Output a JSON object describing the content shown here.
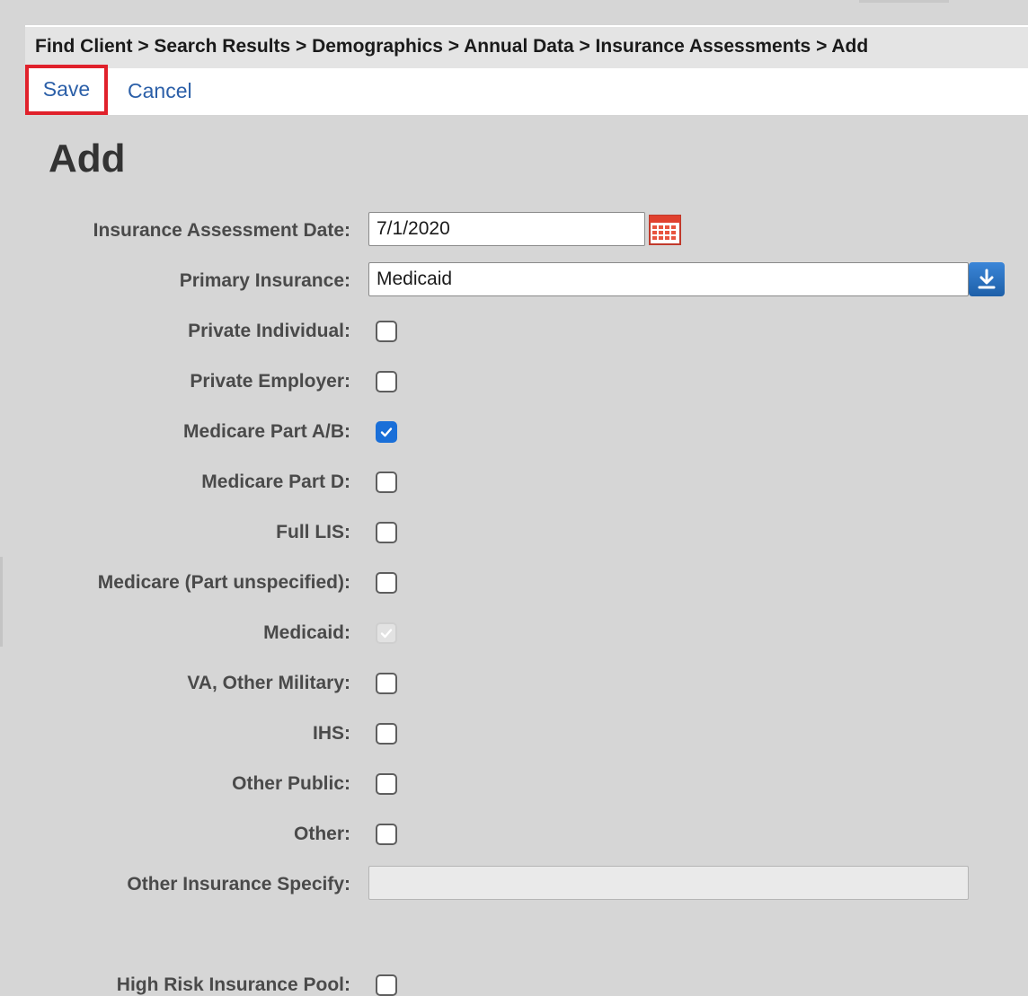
{
  "breadcrumb": "Find Client > Search Results > Demographics > Annual Data > Insurance Assessments > Add",
  "actions": {
    "save": "Save",
    "cancel": "Cancel"
  },
  "page_title": "Add",
  "fields": {
    "assessment_date": {
      "label": "Insurance Assessment Date:",
      "value": "7/1/2020"
    },
    "primary_insurance": {
      "label": "Primary Insurance:",
      "value": "Medicaid"
    },
    "other_specify": {
      "label": "Other Insurance Specify:",
      "value": ""
    }
  },
  "checkboxes": [
    {
      "label": "Private Individual:",
      "checked": false,
      "disabled": false
    },
    {
      "label": "Private Employer:",
      "checked": false,
      "disabled": false
    },
    {
      "label": "Medicare Part A/B:",
      "checked": true,
      "disabled": false
    },
    {
      "label": "Medicare Part D:",
      "checked": false,
      "disabled": false
    },
    {
      "label": "Full LIS:",
      "checked": false,
      "disabled": false
    },
    {
      "label": "Medicare (Part unspecified):",
      "checked": false,
      "disabled": false
    },
    {
      "label": "Medicaid:",
      "checked": true,
      "disabled": true
    },
    {
      "label": "VA, Other Military:",
      "checked": false,
      "disabled": false
    },
    {
      "label": "IHS:",
      "checked": false,
      "disabled": false
    },
    {
      "label": "Other Public:",
      "checked": false,
      "disabled": false
    },
    {
      "label": "Other:",
      "checked": false,
      "disabled": false
    },
    {
      "label": "High Risk Insurance Pool:",
      "checked": false,
      "disabled": false
    }
  ],
  "icons": {
    "calendar": "calendar-icon",
    "dropdown": "download-arrow-icon"
  },
  "colors": {
    "link": "#2b5fa8",
    "highlight": "#e0212b",
    "checked": "#1a6fd8"
  }
}
